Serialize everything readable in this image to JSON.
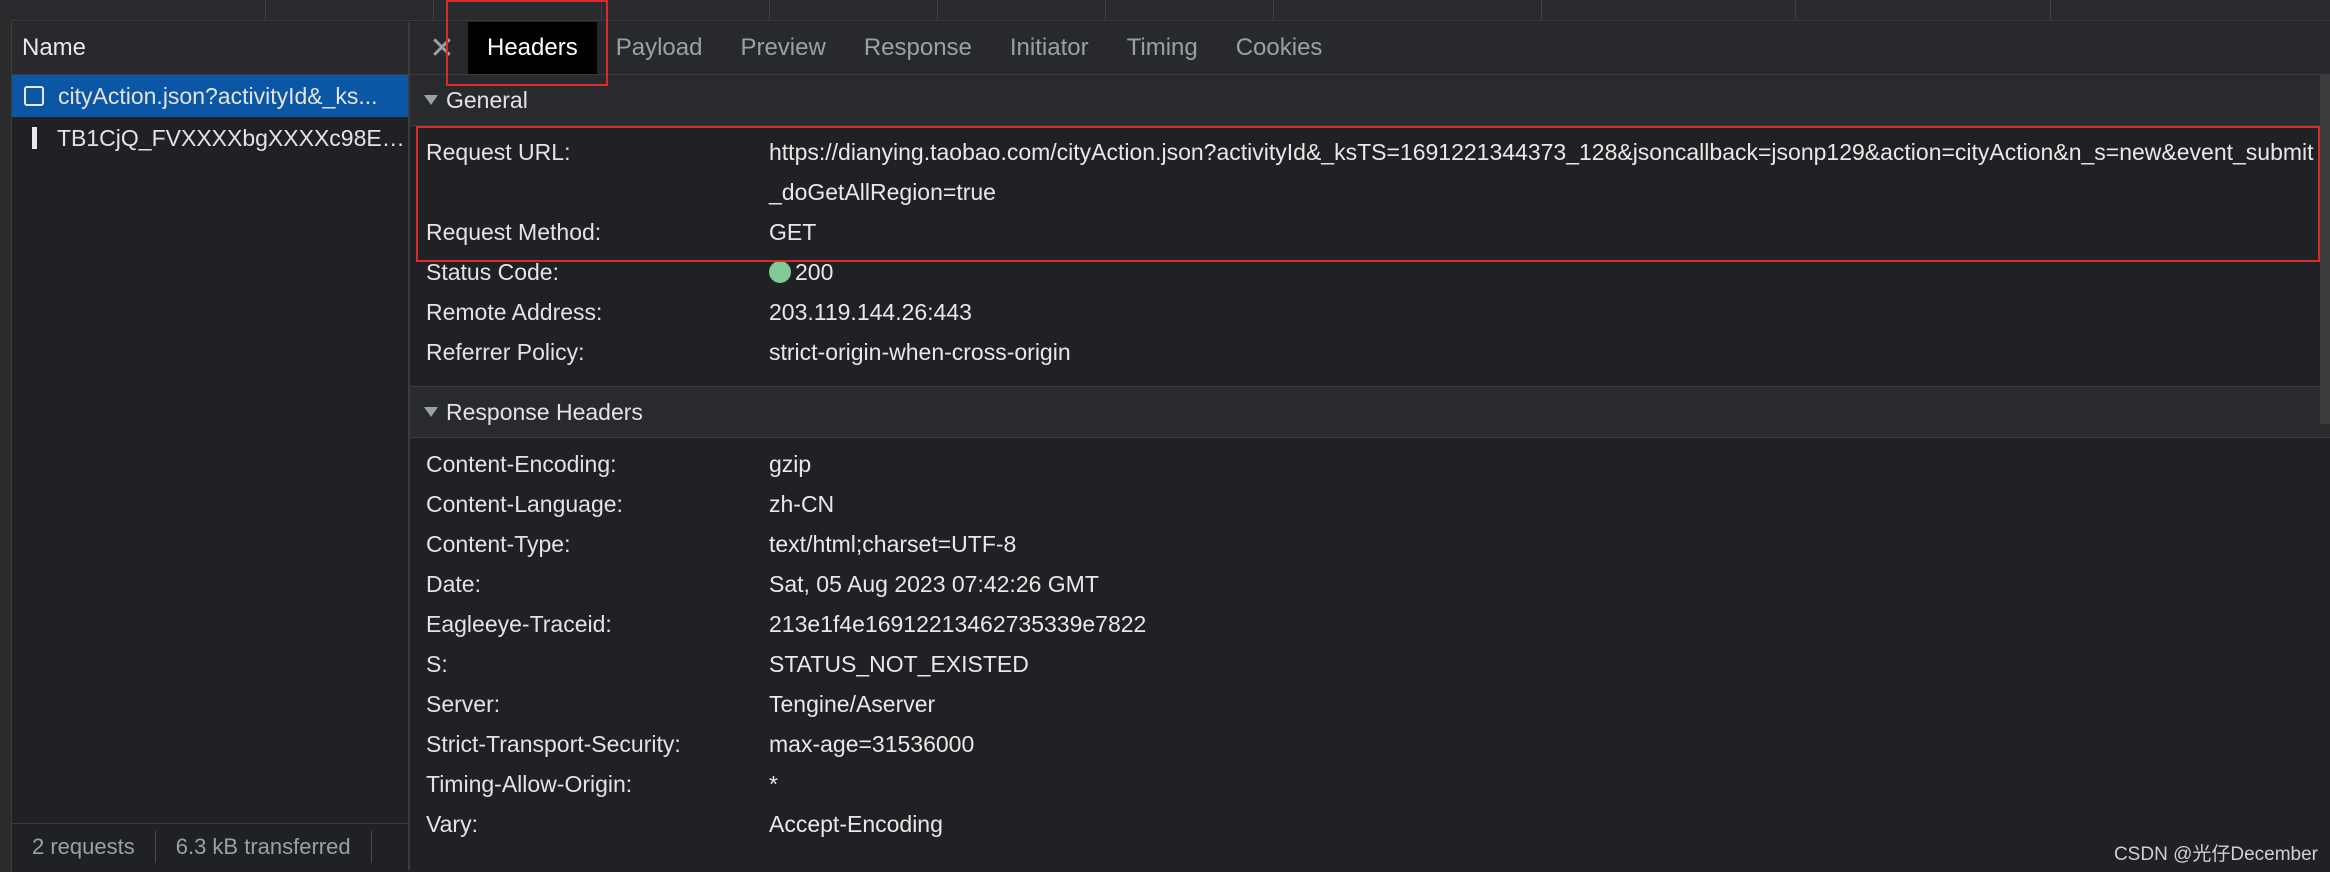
{
  "request_list": {
    "column_header": "Name",
    "rows": [
      {
        "name": "cityAction.json?activityId&_ks..."
      },
      {
        "name": "TB1CjQ_FVXXXXbgXXXXc98EU..."
      }
    ],
    "footer": {
      "requests": "2 requests",
      "transferred": "6.3 kB transferred"
    }
  },
  "tabs": {
    "close_glyph": "✕",
    "items": [
      "Headers",
      "Payload",
      "Preview",
      "Response",
      "Initiator",
      "Timing",
      "Cookies"
    ],
    "active": "Headers"
  },
  "general": {
    "title": "General",
    "rows": [
      {
        "key": "Request URL:",
        "value": "https://dianying.taobao.com/cityAction.json?activityId&_ksTS=1691221344373_128&jsoncallback=jsonp129&action=cityAction&n_s=new&event_submit_doGetAllRegion=true"
      },
      {
        "key": "Request Method:",
        "value": "GET"
      },
      {
        "key": "Status Code:",
        "value": "200"
      },
      {
        "key": "Remote Address:",
        "value": "203.119.144.26:443"
      },
      {
        "key": "Referrer Policy:",
        "value": "strict-origin-when-cross-origin"
      }
    ]
  },
  "response_headers": {
    "title": "Response Headers",
    "rows": [
      {
        "key": "Content-Encoding:",
        "value": "gzip"
      },
      {
        "key": "Content-Language:",
        "value": "zh-CN"
      },
      {
        "key": "Content-Type:",
        "value": "text/html;charset=UTF-8"
      },
      {
        "key": "Date:",
        "value": "Sat, 05 Aug 2023 07:42:26 GMT"
      },
      {
        "key": "Eagleeye-Traceid:",
        "value": "213e1f4e16912213462735339e7822"
      },
      {
        "key": "S:",
        "value": "STATUS_NOT_EXISTED"
      },
      {
        "key": "Server:",
        "value": "Tengine/Aserver"
      },
      {
        "key": "Strict-Transport-Security:",
        "value": "max-age=31536000"
      },
      {
        "key": "Timing-Allow-Origin:",
        "value": "*"
      },
      {
        "key": "Vary:",
        "value": "Accept-Encoding"
      }
    ]
  },
  "watermark": "CSDN @光仔December",
  "colors": {
    "selected_row": "#0b57a5",
    "highlight_box": "#d92b2b",
    "status_ok": "#81c995"
  }
}
